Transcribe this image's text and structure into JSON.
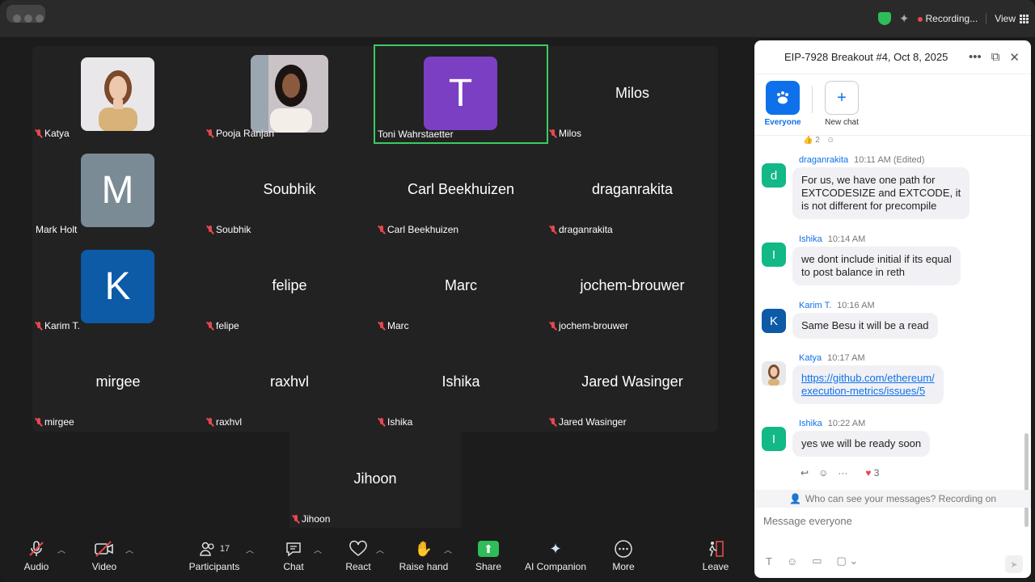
{
  "titlebar": {
    "recording_label": "Recording...",
    "view_label": "View"
  },
  "gallery": {
    "tiles": [
      {
        "name": "Katya",
        "big": "",
        "letter": "",
        "color": ""
      },
      {
        "name": "Pooja Ranjan",
        "big": "",
        "letter": "",
        "color": ""
      },
      {
        "name": "Toni Wahrstaetter",
        "big": "",
        "letter": "T",
        "color": "#7b3fc4"
      },
      {
        "name": "Milos",
        "big": "Milos",
        "letter": "",
        "color": ""
      },
      {
        "name": "Mark Holt",
        "big": "",
        "letter": "M",
        "color": "#7a8b96"
      },
      {
        "name": "Soubhik",
        "big": "Soubhik",
        "letter": "",
        "color": ""
      },
      {
        "name": "Carl Beekhuizen",
        "big": "Carl Beekhuizen",
        "letter": "",
        "color": ""
      },
      {
        "name": "draganrakita",
        "big": "draganrakita",
        "letter": "",
        "color": ""
      },
      {
        "name": "Karim T.",
        "big": "",
        "letter": "K",
        "color": "#0d5aa7"
      },
      {
        "name": "felipe",
        "big": "felipe",
        "letter": "",
        "color": ""
      },
      {
        "name": "Marc",
        "big": "Marc",
        "letter": "",
        "color": ""
      },
      {
        "name": "jochem-brouwer",
        "big": "jochem-brouwer",
        "letter": "",
        "color": ""
      },
      {
        "name": "mirgee",
        "big": "mirgee",
        "letter": "",
        "color": ""
      },
      {
        "name": "raxhvl",
        "big": "raxhvl",
        "letter": "",
        "color": ""
      },
      {
        "name": "Ishika",
        "big": "Ishika",
        "letter": "",
        "color": ""
      },
      {
        "name": "Jared Wasinger",
        "big": "Jared Wasinger",
        "letter": "",
        "color": ""
      }
    ],
    "extra_tile": {
      "name": "Jihoon",
      "big": "Jihoon"
    },
    "active_speaker_color": "#3ccb63"
  },
  "toolbar": {
    "audio": "Audio",
    "video": "Video",
    "participants": "Participants",
    "participants_count": "17",
    "chat": "Chat",
    "react": "React",
    "raise_hand": "Raise hand",
    "share": "Share",
    "ai_companion": "AI Companion",
    "more": "More",
    "leave": "Leave"
  },
  "chat": {
    "title": "EIP-7928 Breakout #4, Oct 8, 2025",
    "tabs": {
      "everyone": "Everyone",
      "new_chat": "New chat"
    },
    "top_reaction_count": "2",
    "messages": [
      {
        "sender": "draganrakita",
        "time": "10:11 AM",
        "edited": "(Edited)",
        "line1": "For us, we have one path for",
        "line2": "EXTCODESIZE and EXTCODE, it",
        "line3": "is not different for precompile",
        "avatar_letter": "d",
        "avatar_color": "#12b886"
      },
      {
        "sender": "Ishika",
        "time": "10:14 AM",
        "line1": "we dont include initial if its equal",
        "line2": "to post balance in reth",
        "avatar_letter": "I",
        "avatar_color": "#12b886"
      },
      {
        "sender": "Karim T.",
        "time": "10:16 AM",
        "line1": "Same Besu it will be a read",
        "avatar_letter": "K",
        "avatar_color": "#0d5aa7"
      },
      {
        "sender": "Katya",
        "time": "10:17 AM",
        "line1": "https://github.com/ethereum/",
        "line2": "execution-metrics/issues/5"
      },
      {
        "sender": "Ishika",
        "time": "10:22 AM",
        "line1": "yes we will be ready soon",
        "avatar_letter": "I",
        "avatar_color": "#12b886",
        "heart_count": "3"
      }
    ],
    "visibility_note": "Who can see your messages? Recording on",
    "input_placeholder": "Message everyone"
  }
}
